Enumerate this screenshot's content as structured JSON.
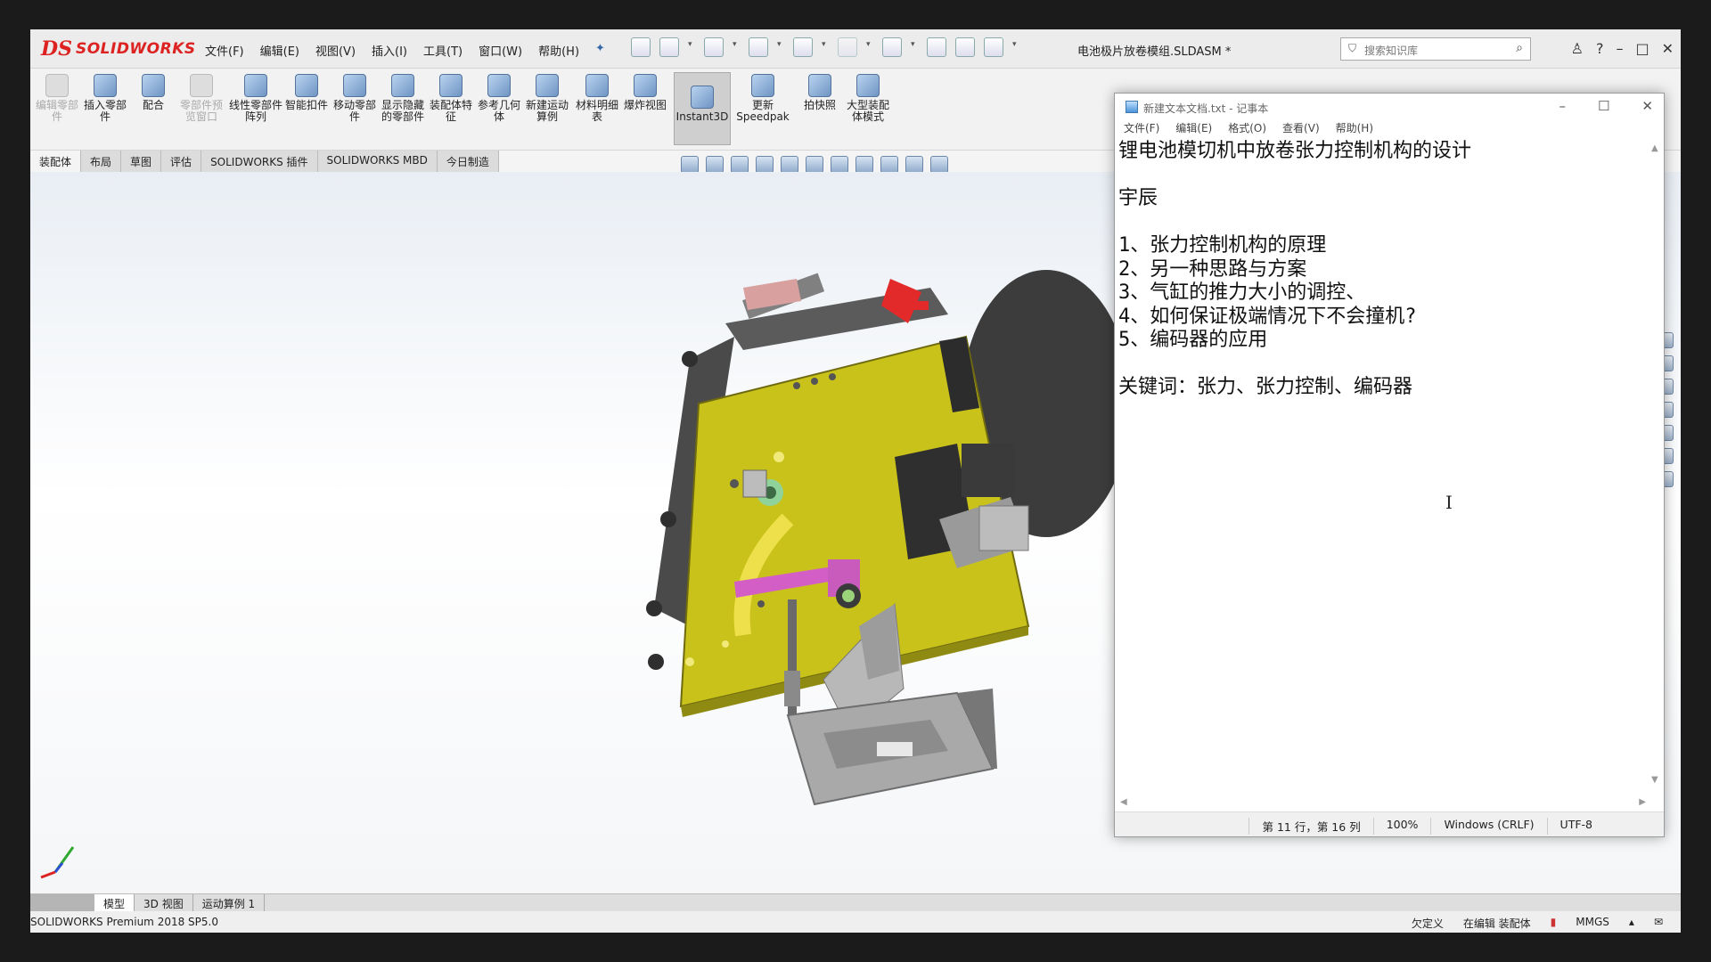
{
  "solidworks": {
    "logo_mark": "DS",
    "logo_text": "SOLIDWORKS",
    "menu": [
      "文件(F)",
      "编辑(E)",
      "视图(V)",
      "插入(I)",
      "工具(T)",
      "窗口(W)",
      "帮助(H)"
    ],
    "document_title": "电池极片放卷模组.SLDASM *",
    "search_placeholder": "搜索知识库",
    "ribbon_buttons": [
      "编辑零部件",
      "插入零部件",
      "配合",
      "零部件预览窗口",
      "线性零部件阵列",
      "智能扣件",
      "移动零部件",
      "显示隐藏的零部件",
      "装配体特征",
      "参考几何体",
      "新建运动算例",
      "材料明细表",
      "爆炸视图",
      "Instant3D",
      "更新Speedpak",
      "拍快照",
      "大型装配体模式"
    ],
    "tabs": [
      "装配体",
      "布局",
      "草图",
      "评估",
      "SOLIDWORKS 插件",
      "SOLIDWORKS MBD",
      "今日制造"
    ],
    "bottom_tabs": [
      "模型",
      "3D 视图",
      "运动算例 1"
    ],
    "status": {
      "version": "SOLIDWORKS Premium 2018 SP5.0",
      "state": "欠定义",
      "editing": "在编辑 装配体",
      "units": "MMGS"
    }
  },
  "notepad": {
    "title": "新建文本文档.txt - 记事本",
    "menu": [
      "文件(F)",
      "编辑(E)",
      "格式(O)",
      "查看(V)",
      "帮助(H)"
    ],
    "lines": [
      "锂电池模切机中放卷张力控制机构的设计",
      "",
      "宇辰",
      "",
      "1、张力控制机构的原理",
      "2、另一种思路与方案",
      "3、气缸的推力大小的调控、",
      "4、如何保证极端情况下不会撞机?",
      "5、编码器的应用",
      "",
      "关键词：张力、张力控制、编码器"
    ],
    "status": {
      "position": "第 11 行，第 16 列",
      "zoom": "100%",
      "line_ending": "Windows (CRLF)",
      "encoding": "UTF-8"
    }
  },
  "colors": {
    "sw_red": "#d22222",
    "plate_yellow": "#c9c21a",
    "accent_magenta": "#d35fc6"
  }
}
